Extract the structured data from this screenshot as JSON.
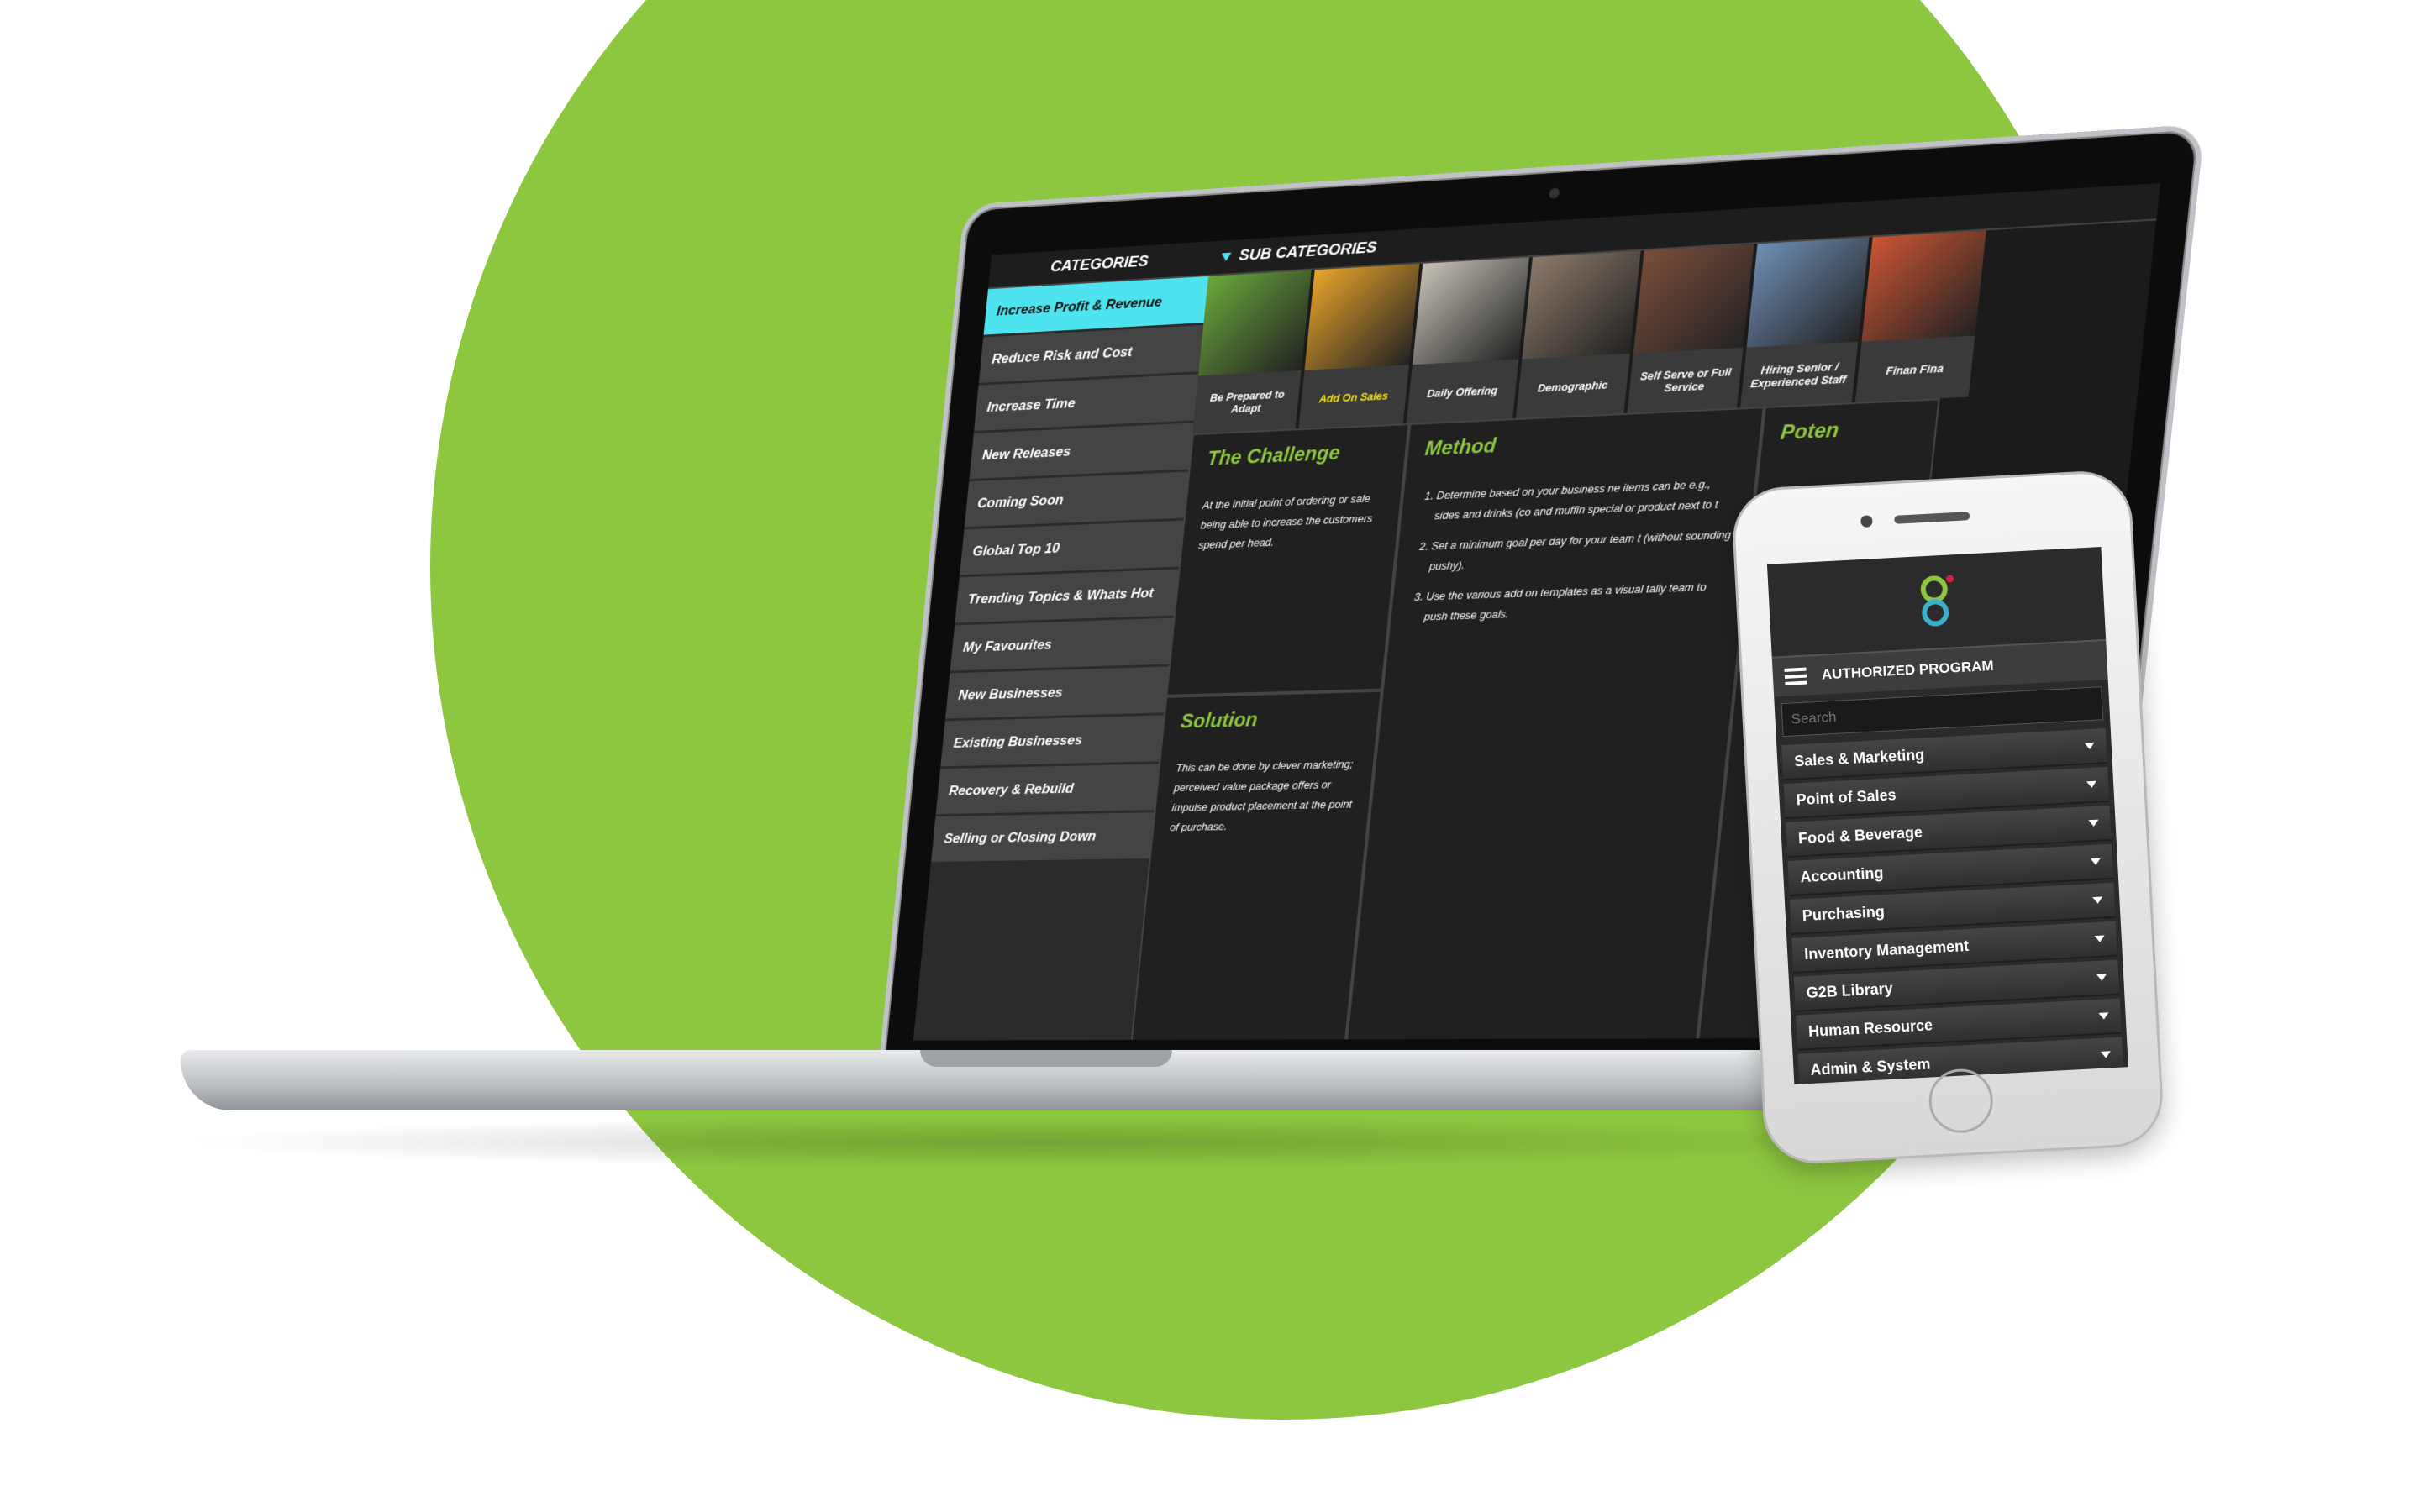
{
  "laptop": {
    "categories_title": "CATEGORIES",
    "categories": [
      "Increase Profit & Revenue",
      "Reduce Risk and Cost",
      "Increase Time",
      "New Releases",
      "Coming Soon",
      "Global Top 10",
      "Trending Topics & Whats Hot",
      "My Favourites",
      "New Businesses",
      "Existing Businesses",
      "Recovery & Rebuild",
      "Selling or Closing Down"
    ],
    "active_category": "Increase Profit & Revenue",
    "subcategories_title": "SUB CATEGORIES",
    "subcategories": [
      {
        "label": "Be Prepared to Adapt",
        "color": "#6aa83b"
      },
      {
        "label": "Add On Sales",
        "color": "#e8a42a"
      },
      {
        "label": "Daily Offering",
        "color": "#c7c2b7"
      },
      {
        "label": "Demographic",
        "color": "#8c7b6a"
      },
      {
        "label": "Self Serve or Full Service",
        "color": "#7a4d3a"
      },
      {
        "label": "Hiring Senior / Experienced Staff",
        "color": "#6f8fb5"
      },
      {
        "label": "Finan Fina",
        "color": "#cc5533"
      }
    ],
    "active_subcategory": "Add On Sales",
    "challenge": {
      "title": "The Challenge",
      "text": "At the initial point of ordering or sale being able to increase the customers spend per head."
    },
    "solution": {
      "title": "Solution",
      "text": "This can be done by clever marketing; perceived value package offers or impulse product placement at the point of purchase."
    },
    "method": {
      "title": "Method",
      "steps": [
        "Determine based on your business ne items can be e.g., sides and drinks (co and muffin special or product next to t",
        "Set a minimum goal per day for your team t (without sounding pushy).",
        "Use the various add on templates as a visual tally team to push these goals."
      ]
    },
    "potential_title": "Poten"
  },
  "phone": {
    "program_label": "AUTHORIZED PROGRAM",
    "search_placeholder": "Search",
    "menu": [
      "Sales & Marketing",
      "Point of Sales",
      "Food & Beverage",
      "Accounting",
      "Purchasing",
      "Inventory Management",
      "G2B Library",
      "Human Resource",
      "Admin & System"
    ]
  },
  "colors": {
    "accent_green": "#8dc63f",
    "active_cyan": "#4ee4ef",
    "active_yellow": "#f7e21b"
  }
}
